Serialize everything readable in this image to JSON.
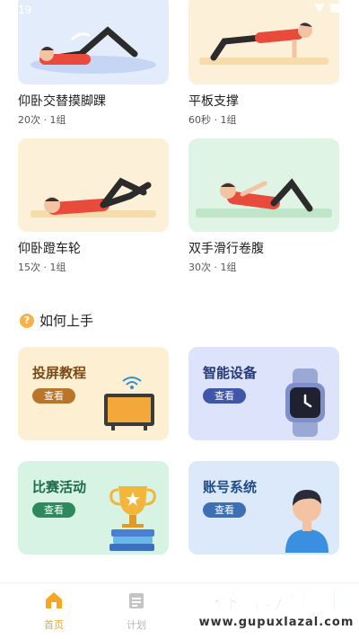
{
  "status_bar": {
    "time": "19"
  },
  "exercises": [
    {
      "title": "仰卧交替摸脚踝",
      "meta": "20次 · 1组"
    },
    {
      "title": "平板支撑",
      "meta": "60秒 · 1组"
    },
    {
      "title": "仰卧蹬车轮",
      "meta": "15次 · 1组"
    },
    {
      "title": "双手滑行卷腹",
      "meta": "30次 · 1组"
    }
  ],
  "section": {
    "title": "如何上手",
    "icon": "question-icon"
  },
  "guides": [
    {
      "title": "投屏教程",
      "button": "查看",
      "icon": "tv-icon"
    },
    {
      "title": "智能设备",
      "button": "查看",
      "icon": "smartwatch-icon"
    },
    {
      "title": "比赛活动",
      "button": "查看",
      "icon": "trophy-icon"
    },
    {
      "title": "账号系统",
      "button": "查看",
      "icon": "user-avatar-icon"
    }
  ],
  "tabbar": {
    "tabs": [
      {
        "label": "首页",
        "icon": "home-icon",
        "active": true
      },
      {
        "label": "计划",
        "icon": "calendar-icon",
        "active": false
      }
    ]
  },
  "watermark": {
    "main": "谷普软件园",
    "sub": "www.gupuxlazal.com"
  },
  "colors": {
    "accent": "#f5a623",
    "tab_inactive": "#b5b5b5",
    "guide_tv_bg": "#fdefd2",
    "guide_device_bg": "#dce3fb",
    "guide_event_bg": "#d7f3e3",
    "guide_account_bg": "#dbe9fb"
  }
}
